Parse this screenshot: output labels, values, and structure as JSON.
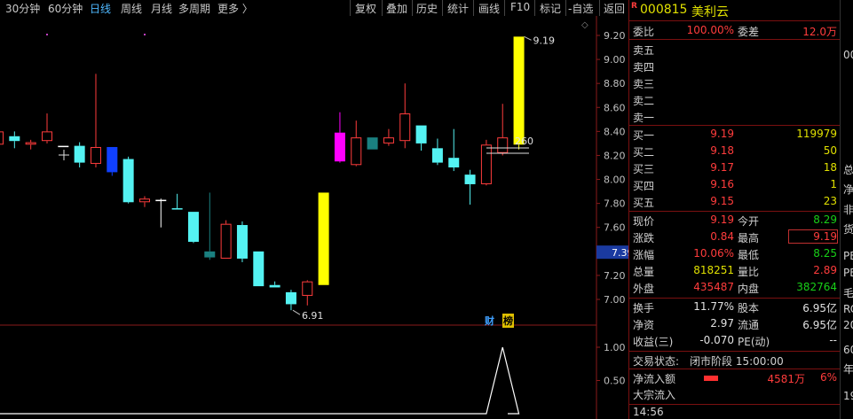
{
  "toolbar": {
    "periods": [
      "30分钟",
      "60分钟",
      "日线",
      "周线",
      "月线",
      "多周期",
      "更多 〉"
    ],
    "active_period": "日线",
    "actions": [
      "复权",
      "叠加",
      "历史",
      "统计",
      "画线",
      "F10",
      "标记",
      "-自选",
      "返回"
    ]
  },
  "stock": {
    "badge": "R",
    "code": "000815",
    "name": "美利云"
  },
  "order_ratio": {
    "label1": "委比",
    "value1": "100.00%",
    "label2": "委差",
    "value2": "12.0万"
  },
  "sells": [
    {
      "label": "卖五"
    },
    {
      "label": "卖四"
    },
    {
      "label": "卖三"
    },
    {
      "label": "卖二"
    },
    {
      "label": "卖一"
    }
  ],
  "buys": [
    {
      "label": "买一",
      "price": "9.19",
      "vol": "119979"
    },
    {
      "label": "买二",
      "price": "9.18",
      "vol": "50"
    },
    {
      "label": "买三",
      "price": "9.17",
      "vol": "18"
    },
    {
      "label": "买四",
      "price": "9.16",
      "vol": "1"
    },
    {
      "label": "买五",
      "price": "9.15",
      "vol": "23"
    }
  ],
  "quote": [
    {
      "l1": "现价",
      "v1": "9.19",
      "c1": "red",
      "l2": "今开",
      "v2": "8.29",
      "c2": "green"
    },
    {
      "l1": "涨跌",
      "v1": "0.84",
      "c1": "red",
      "l2": "最高",
      "v2": "9.19",
      "c2": "red"
    },
    {
      "l1": "涨幅",
      "v1": "10.06%",
      "c1": "red",
      "l2": "最低",
      "v2": "8.25",
      "c2": "green"
    },
    {
      "l1": "总量",
      "v1": "818251",
      "c1": "yellow",
      "l2": "量比",
      "v2": "2.89",
      "c2": "red"
    },
    {
      "l1": "外盘",
      "v1": "435487",
      "c1": "red",
      "l2": "内盘",
      "v2": "382764",
      "c2": "green"
    }
  ],
  "fundamentals": [
    {
      "l1": "换手",
      "v1": "11.77%",
      "l2": "股本",
      "v2": "6.95亿"
    },
    {
      "l1": "净资",
      "v1": "2.97",
      "l2": "流通",
      "v2": "6.95亿"
    },
    {
      "l1": "收益(三)",
      "v1": "-0.070",
      "l2": "PE(动)",
      "v2": "--"
    }
  ],
  "trade_status": {
    "label": "交易状态:",
    "value": "闭市阶段 15:00:00"
  },
  "net_inflow": {
    "label": "净流入额",
    "value": "4581万",
    "pct": "6%"
  },
  "block_trade": {
    "label": "大宗流入"
  },
  "time": "14:56",
  "edge_text": [
    "00",
    "总",
    "净",
    "非",
    "货",
    "PE",
    "PE",
    "毛",
    "RC",
    "20",
    "60",
    "年",
    "19"
  ],
  "price_axis": {
    "ticks": [
      "9.20",
      "9.00",
      "8.80",
      "8.60",
      "8.40",
      "8.20",
      "8.00",
      "7.80",
      "7.60",
      "7.40",
      "7.20",
      "7.00"
    ],
    "current": "7.39"
  },
  "indicator_axis": {
    "ticks": [
      "1.00",
      "0.50"
    ]
  },
  "annotations": {
    "high": "9.19",
    "low": "6.91",
    "mid": "260"
  },
  "badges": {
    "cai": "财",
    "bang": "榜"
  },
  "chart_data": {
    "type": "candlestick",
    "ylim": [
      6.82,
      9.28
    ],
    "candles": [
      {
        "o": 8.4,
        "h": 8.44,
        "l": 8.26,
        "c": 8.29,
        "k": "u"
      },
      {
        "o": 8.32,
        "h": 8.4,
        "l": 8.26,
        "c": 8.36,
        "k": "d"
      },
      {
        "o": 8.31,
        "h": 8.33,
        "l": 8.25,
        "c": 8.29,
        "k": "u"
      },
      {
        "o": 8.32,
        "h": 8.55,
        "l": 8.3,
        "c": 8.4,
        "k": "u"
      },
      {
        "o": 8.28,
        "h": 8.28,
        "l": 8.28,
        "c": 8.28,
        "k": "x"
      },
      {
        "o": 8.28,
        "h": 8.31,
        "l": 8.1,
        "c": 8.14,
        "k": "d"
      },
      {
        "o": 8.13,
        "h": 8.88,
        "l": 8.1,
        "c": 8.27,
        "k": "u"
      },
      {
        "o": 8.27,
        "h": 8.27,
        "l": 8.03,
        "c": 8.06,
        "k": "b"
      },
      {
        "o": 8.17,
        "h": 8.19,
        "l": 7.8,
        "c": 7.81,
        "k": "d"
      },
      {
        "o": 7.84,
        "h": 7.86,
        "l": 7.77,
        "c": 7.81,
        "k": "u"
      },
      {
        "o": 7.83,
        "h": 7.84,
        "l": 7.6,
        "c": 7.82,
        "k": "x"
      },
      {
        "o": 7.76,
        "h": 7.88,
        "l": 7.75,
        "c": 7.76,
        "k": "d"
      },
      {
        "o": 7.73,
        "h": 7.73,
        "l": 7.47,
        "c": 7.48,
        "k": "d"
      },
      {
        "o": 7.35,
        "h": 7.89,
        "l": 7.33,
        "c": 7.4,
        "k": "t"
      },
      {
        "o": 7.34,
        "h": 7.66,
        "l": 7.34,
        "c": 7.63,
        "k": "u"
      },
      {
        "o": 7.62,
        "h": 7.65,
        "l": 7.31,
        "c": 7.34,
        "k": "d"
      },
      {
        "o": 7.4,
        "h": 7.4,
        "l": 7.11,
        "c": 7.11,
        "k": "d"
      },
      {
        "o": 7.12,
        "h": 7.15,
        "l": 7.1,
        "c": 7.1,
        "k": "d"
      },
      {
        "o": 7.06,
        "h": 7.08,
        "l": 6.91,
        "c": 6.96,
        "k": "d"
      },
      {
        "o": 7.03,
        "h": 7.16,
        "l": 6.95,
        "c": 7.15,
        "k": "u"
      },
      {
        "o": 7.12,
        "h": 7.89,
        "l": 7.12,
        "c": 7.89,
        "k": "y"
      },
      {
        "o": 8.39,
        "h": 8.56,
        "l": 8.14,
        "c": 8.15,
        "k": "m"
      },
      {
        "o": 8.12,
        "h": 8.49,
        "l": 8.11,
        "c": 8.35,
        "k": "u"
      },
      {
        "o": 8.35,
        "h": 8.35,
        "l": 8.25,
        "c": 8.25,
        "k": "t"
      },
      {
        "o": 8.3,
        "h": 8.42,
        "l": 8.28,
        "c": 8.35,
        "k": "u"
      },
      {
        "o": 8.32,
        "h": 8.8,
        "l": 8.26,
        "c": 8.55,
        "k": "u"
      },
      {
        "o": 8.45,
        "h": 8.45,
        "l": 8.24,
        "c": 8.3,
        "k": "d"
      },
      {
        "o": 8.26,
        "h": 8.34,
        "l": 8.12,
        "c": 8.14,
        "k": "d"
      },
      {
        "o": 8.18,
        "h": 8.42,
        "l": 8.07,
        "c": 8.1,
        "k": "d"
      },
      {
        "o": 8.04,
        "h": 8.08,
        "l": 7.79,
        "c": 7.96,
        "k": "d"
      },
      {
        "o": 7.96,
        "h": 8.33,
        "l": 7.95,
        "c": 8.29,
        "k": "u"
      },
      {
        "o": 8.22,
        "h": 8.63,
        "l": 8.2,
        "c": 8.35,
        "k": "u"
      },
      {
        "o": 8.29,
        "h": 9.19,
        "l": 8.25,
        "c": 9.19,
        "k": "y"
      }
    ],
    "indicator": {
      "ylim": [
        0,
        1.1
      ],
      "values": [
        0,
        0,
        0,
        0,
        0,
        0,
        0,
        0,
        0,
        0,
        0,
        0,
        0,
        0,
        0,
        0,
        0,
        0,
        0,
        0,
        0,
        0,
        0,
        0,
        0,
        0,
        0,
        0,
        0,
        0,
        0,
        1,
        0
      ]
    }
  }
}
